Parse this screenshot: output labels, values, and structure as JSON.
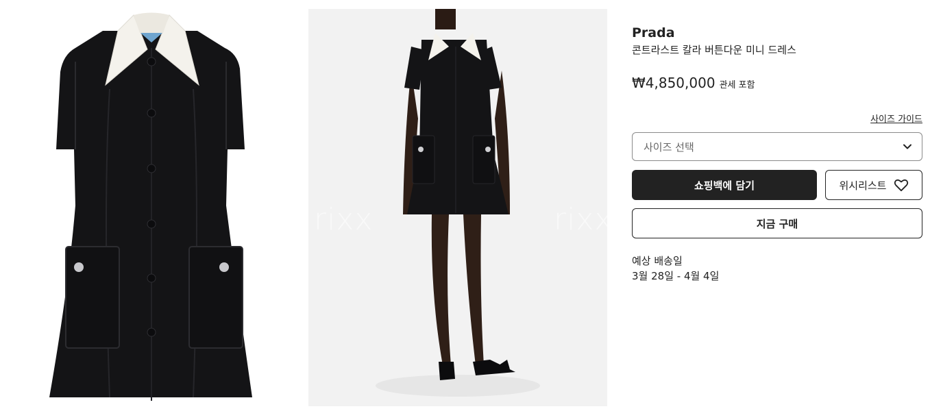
{
  "gallery": {
    "images": [
      {
        "icon": "dress-flat-image"
      },
      {
        "icon": "model-wearing-dress-image"
      }
    ],
    "watermark_left": "rixx",
    "watermark_right": "rixx"
  },
  "product": {
    "brand": "Prada",
    "name": "콘트라스트 칼라 버튼다운 미니 드레스",
    "price": "₩4,850,000",
    "price_note": "관세 포함"
  },
  "actions": {
    "size_guide": "사이즈 가이드",
    "size_select_placeholder": "사이즈 선택",
    "add_to_bag": "쇼핑백에 담기",
    "wishlist": "위시리스트",
    "buy_now": "지금 구매"
  },
  "delivery": {
    "label": "예상 배송일",
    "dates": "3월 28일 - 4월 4일"
  },
  "colors": {
    "primary": "#222222",
    "dress": "#141416",
    "collar": "#f4f2ec",
    "photo_bg": "#f1f1f1"
  }
}
